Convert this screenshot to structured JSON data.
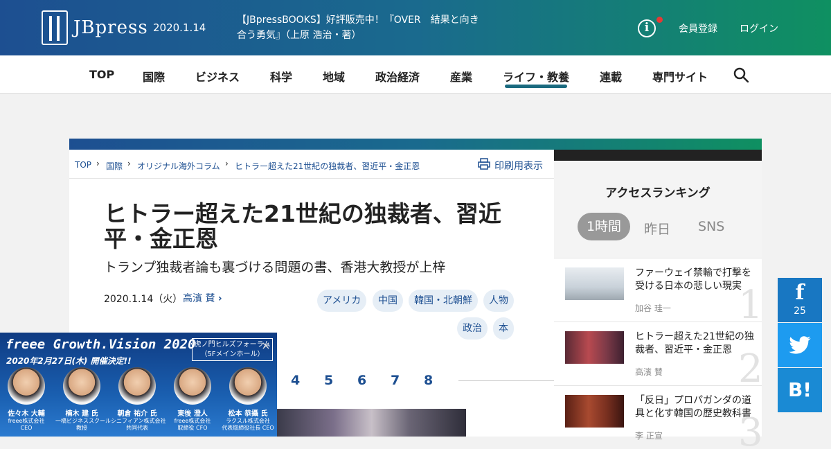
{
  "header": {
    "logo": "JBpress",
    "date": "2020.1.14",
    "promo": "【JBpressBOOKS】好評販売中！『OVER　結果と向き合う勇気』（上原 浩治・著）",
    "register": "会員登録",
    "login": "ログイン"
  },
  "nav": {
    "items": [
      "TOP",
      "国際",
      "ビジネス",
      "科学",
      "地域",
      "政治経済",
      "産業",
      "ライフ・教養",
      "連載",
      "専門サイト"
    ],
    "active": "ライフ・教養"
  },
  "breadcrumb": [
    "TOP",
    "国際",
    "オリジナル海外コラム",
    "ヒトラー超えた21世紀の独裁者、習近平・金正恩"
  ],
  "print": "印刷用表示",
  "article": {
    "title": "ヒトラー超えた21世紀の独裁者、習近平・金正恩",
    "subtitle": "トランプ独裁者論も裏づける問題の書、香港大教授が上梓",
    "date": "2020.1.14（火）",
    "author": "高濱 賛",
    "tags": [
      "アメリカ",
      "中国",
      "韓国・北朝鮮",
      "人物",
      "政治",
      "本"
    ],
    "pages": [
      "4",
      "5",
      "6",
      "7",
      "8"
    ]
  },
  "ranking": {
    "title": "アクセスランキング",
    "tabs": [
      "1時間",
      "昨日",
      "SNS"
    ],
    "active_tab": "1時間",
    "items": [
      {
        "rank": "1",
        "title": "ファーウェイ禁輸で打撃を受ける日本の悲しい現実",
        "author": "加谷 珪一"
      },
      {
        "rank": "2",
        "title": "ヒトラー超えた21世紀の独裁者、習近平・金正恩",
        "author": "高濱 賛"
      },
      {
        "rank": "3",
        "title": "「反日」プロパガンダの道具と化す韓国の歴史教科書",
        "author": "李 正宣"
      }
    ]
  },
  "social": {
    "facebook_count": "25",
    "hatena": "B!"
  },
  "ad": {
    "title": "freee Growth.Vision 2020",
    "date": "2020年2月27日(木) 開催決定!!",
    "venue": "虎ノ門ヒルズフォーラム（5Fメインホール）",
    "close": "×",
    "speakers": [
      {
        "name": "佐々木 大輔",
        "company": "freee株式会社",
        "role": "CEO"
      },
      {
        "name": "楠木 建 氏",
        "company": "一橋ビジネススクール",
        "role": "教授"
      },
      {
        "name": "朝倉 祐介 氏",
        "company": "シニフィアン株式会社",
        "role": "共同代表"
      },
      {
        "name": "東後 澄人",
        "company": "freee株式会社",
        "role": "取締役 CFO"
      },
      {
        "name": "松本 恭攝 氏",
        "company": "ラクスル株式会社",
        "role": "代表取締役社長 CEO"
      }
    ]
  },
  "colors": {
    "brand_blue": "#1d4f91",
    "brand_green": "#0f9061",
    "accent": "#1a6a7f"
  }
}
